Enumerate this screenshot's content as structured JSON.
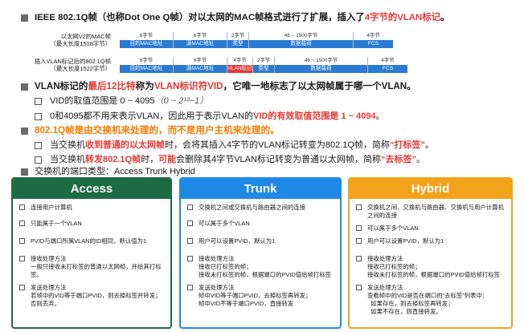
{
  "heading1": {
    "prefix": "IEEE 802.1Q帧（也称Dot One Q帧）对以太网的MAC帧格式进行了扩展，插入了",
    "highlight": "4字节的VLAN标记",
    "suffix": "。"
  },
  "frames": {
    "row1": {
      "label_line1": "以太网V2的MAC帧",
      "label_line2": "（最大长度1518字节）",
      "segments": [
        {
          "top": "6字节",
          "bottom": "目的MAC地址"
        },
        {
          "top": "6字节",
          "bottom": "源MAC地址"
        },
        {
          "top": "2字节",
          "bottom": "类型"
        },
        {
          "top": "46 ~ 1500字节",
          "bottom": "数据载荷"
        },
        {
          "top": "4字节",
          "bottom": "FCS"
        }
      ]
    },
    "row2": {
      "label_line1": "插入VLAN标记后的802.1Q帧",
      "label_line2": "（最大长度1522字节）",
      "segments": [
        {
          "top": "6字节",
          "bottom": "目的MAC地址"
        },
        {
          "top": "6字节",
          "bottom": "源MAC地址"
        },
        {
          "top": "4字节",
          "bottom": "VLAN标记"
        },
        {
          "top": "2字节",
          "bottom": "类型"
        },
        {
          "top": "46 ~ 1500字节",
          "bottom": "数据载荷"
        },
        {
          "top": "4字节",
          "bottom": "FCS"
        }
      ]
    }
  },
  "heading2": {
    "a": "VLAN标记的",
    "b": "最后12比特",
    "c": "称为",
    "d": "VLAN标识符VID",
    "e": "，它唯一地标志了以太网帧属于哪一个VLAN。"
  },
  "vid_range": {
    "text": "VID的取值范围是 0 ~ 4095",
    "formula": "（0 ~ 2¹²−1）"
  },
  "vid_valid": {
    "a": "0和4095都不用来表示VLAN，因此用于表示VLAN的",
    "b": "VID的有效取值范围是 1 ~ 4094",
    "c": "。"
  },
  "heading3": "802.1Q帧是由交换机来处理的，而不是用户主机来处理的。",
  "tagging": {
    "a": "当交换机",
    "b": "收到普通的以太网帧",
    "c": "时，会将其插入4字节的VLAN标记转变为802.1Q帧，简称",
    "d": "“打标签”",
    "e": "。"
  },
  "untagging": {
    "a": "当交换机",
    "b": "转发802.1Q帧",
    "c": "时，",
    "d": "可能",
    "e": "会删除其4字节VLAN标记转变为普通以太网帧，简称",
    "f": "“去标签”",
    "g": "。"
  },
  "heading4": "交换机的端口类型：Access   Trunk   Hybrid",
  "cards": {
    "access": {
      "title": "Access",
      "items": [
        [
          "连接用户计算机"
        ],
        [
          "只能属于一个VLAN"
        ],
        [
          "PVID与端口所属VLAN的ID相同，默认值为1"
        ],
        [
          "接收处理方法",
          "一般只接收未打标签的普通以太网帧，并给其打标签。"
        ],
        [
          "发送处理方法",
          "若帧中的VID等于端口PVID，则去掉标签并转发；",
          "否则丢弃。"
        ]
      ]
    },
    "trunk": {
      "title": "Trunk",
      "items": [
        [
          "交换机之间或交换机与路由器之间的连接"
        ],
        [
          "可以属于多个VLAN"
        ],
        [
          "用户可以设置PVID，默认为1"
        ],
        [
          "接收处理方法",
          "接收已打标签的帧；",
          "接收未打标签的帧，根据端口的PVID值给帧打标签"
        ],
        [
          "发送处理方法",
          "帧中VID等于端口PVID，去掉标签再转发；",
          "帧中VID不等于端口PVID，直接转发"
        ]
      ]
    },
    "hybrid": {
      "title": "Hybrid",
      "items": [
        [
          "交换机之间、交换机与路由器、交换机与用户计算机",
          "之间的连接"
        ],
        [
          "可以属于多个VLAN"
        ],
        [
          "用户可以设置PVID，默认为1"
        ],
        [
          "接收处理方法",
          "接收已打标签的帧；",
          "接收未打标签的帧，根据端口的PVID值给帧打标签"
        ],
        [
          "发送处理方法",
          "查看帧中的VID是否在端口的“去标签”列表中：",
          "  如果存在，则去掉标签再转发；",
          "  如果不存在，则直接转发。"
        ]
      ]
    }
  },
  "colors": {
    "access": "#1c6b45",
    "trunk": "#1f8ae6",
    "hybrid": "#f2a31c",
    "red": "#e53935",
    "orange": "#f57c00",
    "frame_blue": "#2a7ad3"
  }
}
